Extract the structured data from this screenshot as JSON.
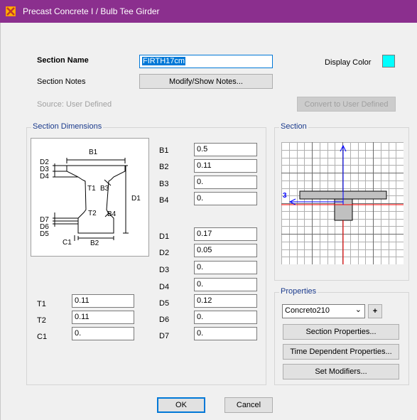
{
  "window": {
    "title": "Precast Concrete I / Bulb Tee Girder"
  },
  "top": {
    "section_name_label": "Section Name",
    "section_name_value": "FIRTH17cm",
    "display_color_label": "Display Color",
    "display_color": "#00ffff",
    "section_notes_label": "Section Notes",
    "modify_notes_button": "Modify/Show Notes...",
    "source_label": "Source:  User Defined",
    "convert_button": "Convert to User Defined"
  },
  "dimensions": {
    "group_title": "Section Dimensions",
    "diagram_labels": {
      "B1": "B1",
      "B2": "B2",
      "B3": "B3",
      "B4": "B4",
      "D1": "D1",
      "D2": "D2",
      "D3": "D3",
      "D4": "D4",
      "D5": "D5",
      "D6": "D6",
      "D7": "D7",
      "T1": "T1",
      "T2": "T2",
      "C1": "C1"
    },
    "fields_mid_top": [
      {
        "label": "B1",
        "value": "0.5"
      },
      {
        "label": "B2",
        "value": "0.11"
      },
      {
        "label": "B3",
        "value": "0."
      },
      {
        "label": "B4",
        "value": "0."
      }
    ],
    "fields_mid_bottom": [
      {
        "label": "D1",
        "value": "0.17"
      },
      {
        "label": "D2",
        "value": "0.05"
      },
      {
        "label": "D3",
        "value": "0."
      },
      {
        "label": "D4",
        "value": "0."
      },
      {
        "label": "D5",
        "value": "0.12"
      },
      {
        "label": "D6",
        "value": "0."
      },
      {
        "label": "D7",
        "value": "0."
      }
    ],
    "fields_left": [
      {
        "label": "T1",
        "value": "0.11"
      },
      {
        "label": "T2",
        "value": "0.11"
      },
      {
        "label": "C1",
        "value": "0."
      }
    ]
  },
  "section": {
    "group_title": "Section",
    "axis_label": "3"
  },
  "properties": {
    "group_title": "Properties",
    "material_selected": "Concreto210",
    "add_button": "+",
    "section_properties_button": "Section Properties...",
    "time_dependent_button": "Time Dependent Properties...",
    "set_modifiers_button": "Set Modifiers..."
  },
  "footer": {
    "ok_button": "OK",
    "cancel_button": "Cancel"
  },
  "colors": {
    "titlebar": "#8b2f8e",
    "section_fill": "#c0c0c0",
    "axis_red": "#ff0000",
    "axis_blue": "#0000ff"
  }
}
